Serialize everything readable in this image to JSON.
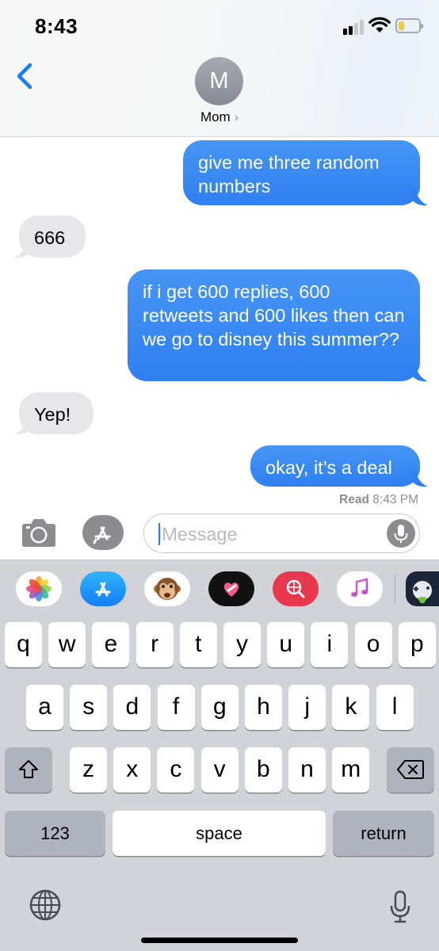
{
  "status_bar": {
    "time": "8:43",
    "signal_icon": "cellular-signal-icon",
    "wifi_icon": "wifi-icon",
    "battery_icon": "battery-low-icon",
    "battery_level": 0.25,
    "battery_color": "#f7cb2b"
  },
  "nav": {
    "back_icon": "chevron-left-icon",
    "avatar_initial": "M",
    "contact_name": "Mom",
    "contact_chevron": "›"
  },
  "messages": [
    {
      "direction": "sent",
      "text": "give me three random numbers"
    },
    {
      "direction": "received",
      "text": "666"
    },
    {
      "direction": "sent",
      "text": "if i get 600 replies, 600 retweets and 600 likes then can we go to disney this summer??"
    },
    {
      "direction": "received",
      "text": "Yep!"
    },
    {
      "direction": "sent",
      "text": "okay, it’s a deal"
    }
  ],
  "read_receipt": {
    "label": "Read",
    "time": "8:43 PM"
  },
  "compose": {
    "camera_icon": "camera-icon",
    "apps_icon": "app-store-icon",
    "placeholder": "iMessage",
    "value": "",
    "mic_icon": "microphone-icon"
  },
  "app_strip": [
    {
      "name": "photos-app-icon"
    },
    {
      "name": "app-store-app-icon"
    },
    {
      "name": "animoji-monkey-icon"
    },
    {
      "name": "digital-touch-icon"
    },
    {
      "name": "images-search-icon"
    },
    {
      "name": "music-icon"
    },
    {
      "name": "game-app-icon"
    }
  ],
  "keyboard": {
    "row1": [
      "q",
      "w",
      "e",
      "r",
      "t",
      "y",
      "u",
      "i",
      "o",
      "p"
    ],
    "row2": [
      "a",
      "s",
      "d",
      "f",
      "g",
      "h",
      "j",
      "k",
      "l"
    ],
    "row3": [
      "z",
      "x",
      "c",
      "v",
      "b",
      "n",
      "m"
    ],
    "shift_icon": "shift-icon",
    "delete_icon": "backspace-icon",
    "numbers_label": "123",
    "space_label": "space",
    "return_label": "return",
    "globe_icon": "globe-icon",
    "dictation_icon": "microphone-icon"
  },
  "colors": {
    "sent_bubble": "#2f7ff1",
    "received_bubble": "#e6e6eb",
    "ios_blue": "#147efb",
    "keyboard_bg": "#d1d3d9"
  }
}
